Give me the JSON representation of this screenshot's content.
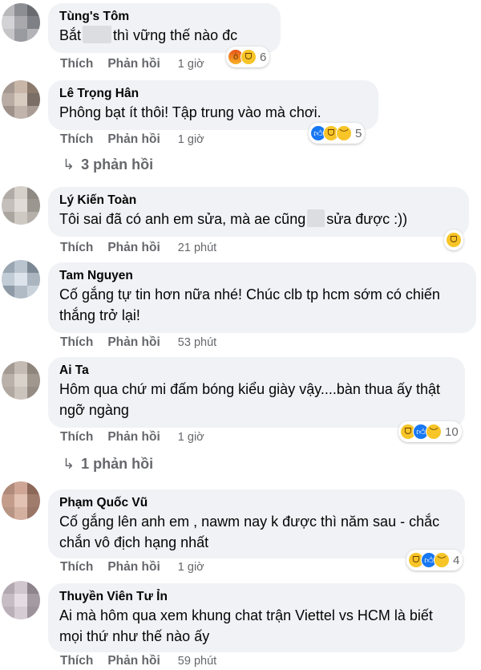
{
  "comments": [
    {
      "author": "Tùng's Tôm",
      "text_before": "Bắt",
      "text_after": "thì vững thế nào đc",
      "like": "Thích",
      "reply": "Phản hồi",
      "time": "1 giờ",
      "reaction_count": "6",
      "reaction_icons": [
        "angry-icon",
        "haha-icon"
      ]
    },
    {
      "author": "Lê Trọng Hân",
      "text": "Phông bạt ít thôi! Tập trung vào mà chơi.",
      "like": "Thích",
      "reply": "Phản hồi",
      "time": "1 giờ",
      "reaction_count": "5",
      "reaction_icons": [
        "like-icon",
        "haha-icon",
        "sad-icon"
      ],
      "replies_label": "3 phản hồi"
    },
    {
      "author": "Lý Kiến Toàn",
      "text_before": "Tôi sai đã có anh em sửa, mà ae cũng",
      "text_after": "sửa được :))",
      "like": "Thích",
      "reply": "Phản hồi",
      "time": "21 phút",
      "reaction_icons": [
        "haha-icon"
      ]
    },
    {
      "author": "Tam Nguyen",
      "text": "Cố gắng tự tin hơn nữa nhé! Chúc clb tp hcm sớm có chiến thắng trở lại!",
      "like": "Thích",
      "reply": "Phản hồi",
      "time": "53 phút"
    },
    {
      "author": "Ai Ta",
      "text": "Hôm qua chứ mi đấm bóng kiểu giày vậy....bàn thua ấy thật ngỡ ngàng",
      "like": "Thích",
      "reply": "Phản hồi",
      "time": "1 giờ",
      "reaction_count": "10",
      "reaction_icons": [
        "haha-icon",
        "like-icon",
        "sad-icon"
      ],
      "replies_label": "1 phản hồi"
    },
    {
      "author": "Phạm Quốc Vũ",
      "text": "Cố gắng lên anh em , nawm nay k được thì năm sau - chắc chắn vô địch hạng nhất",
      "like": "Thích",
      "reply": "Phản hồi",
      "time": "1 giờ",
      "reaction_count": "4",
      "reaction_icons": [
        "haha-icon",
        "like-icon",
        "sad-icon"
      ]
    },
    {
      "author": "Thuyền Viên Tư Ỉn",
      "text": "Ai mà hôm qua xem khung chat trận Viettel vs HCM là biết mọi thứ như thế nào ấy",
      "like": "Thích",
      "reply": "Phản hồi",
      "time": "59 phút"
    }
  ],
  "reply_arrow": "↳",
  "colors": {
    "bubble": "#f0f2f5",
    "secondary_text": "#65676b",
    "like_blue": "#1877f2"
  }
}
